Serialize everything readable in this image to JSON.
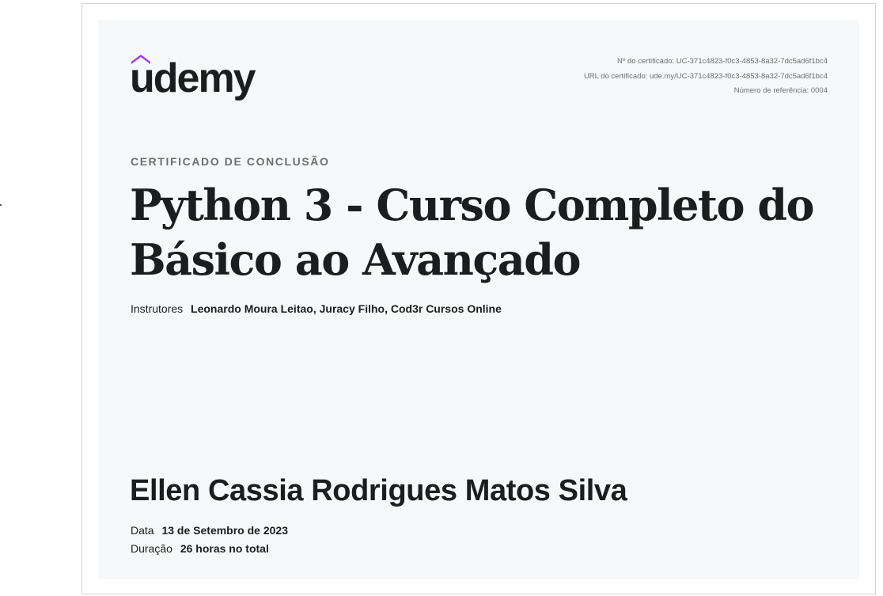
{
  "brand": {
    "logo_text": "udemy",
    "accent_color": "#a435f0"
  },
  "certificate_meta": {
    "number": "Nº do certificado: UC-371c4823-f0c3-4853-8a32-7dc5ad6f1bc4",
    "url": "URL do certificado: ude.my/UC-371c4823-f0c3-4853-8a32-7dc5ad6f1bc4",
    "reference": "Número de referência: 0004"
  },
  "heading": "CERTIFICADO DE CONCLUSÃO",
  "course": {
    "title_line1": "Python 3 - Curso Completo do",
    "title_line2": "Básico ao Avançado"
  },
  "instructors": {
    "label": "Instrutores",
    "names": [
      "Leonardo Moura Leitao,",
      "Juracy Filho,",
      "Cod3r Cursos Online"
    ]
  },
  "recipient": "Ellen Cassia Rodrigues Matos Silva",
  "details": {
    "date_label": "Data",
    "date_value": "13 de Setembro de 2023",
    "duration_label": "Duração",
    "duration_value": "26 horas no total"
  }
}
